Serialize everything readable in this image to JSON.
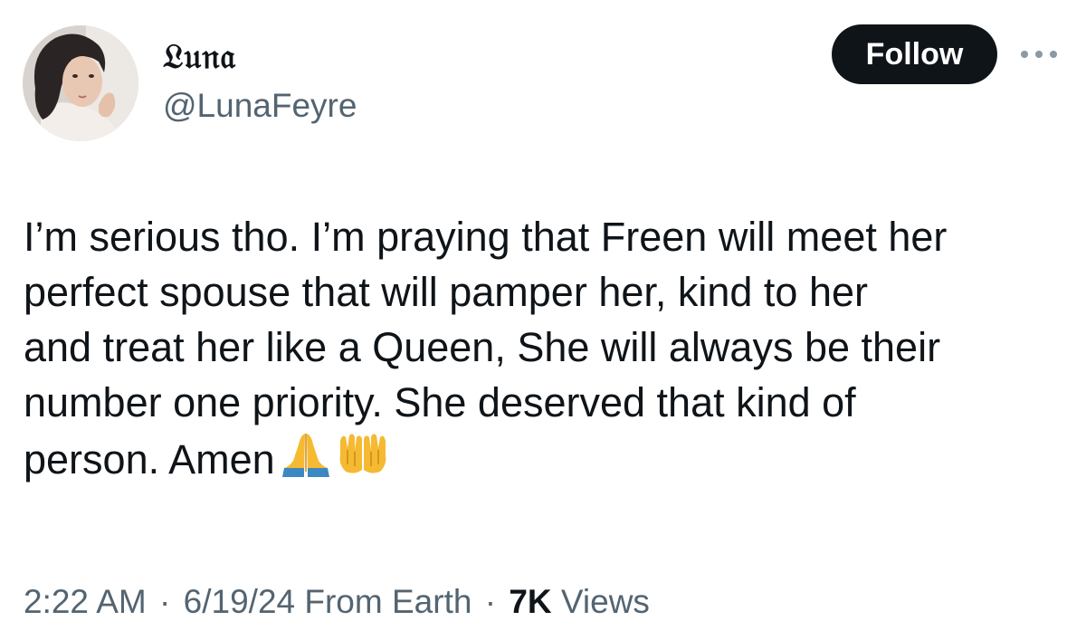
{
  "author": {
    "display_name": "𝔏𝔲𝔫𝔞",
    "handle": "@LunaFeyre",
    "avatar": "profile-photo"
  },
  "actions": {
    "follow_label": "Follow",
    "more_icon": "more-dots-icon"
  },
  "tweet": {
    "lines": [
      "I’m serious tho. I’m praying that Freen will meet her",
      "perfect spouse that will pamper her, kind to her",
      "and treat her like a Queen, She will always be their",
      "number one priority. She deserved that kind of",
      "person. Amen"
    ],
    "emojis": [
      "folded-hands-emoji",
      "palms-up-together-emoji"
    ]
  },
  "meta": {
    "time": "2:22 AM",
    "separator": "·",
    "date_source": "6/19/24 From Earth",
    "views_count": "7K",
    "views_label": "Views"
  },
  "colors": {
    "text_primary": "#0f1419",
    "text_secondary": "#536471",
    "follow_bg": "#0f1419",
    "follow_text": "#ffffff"
  }
}
